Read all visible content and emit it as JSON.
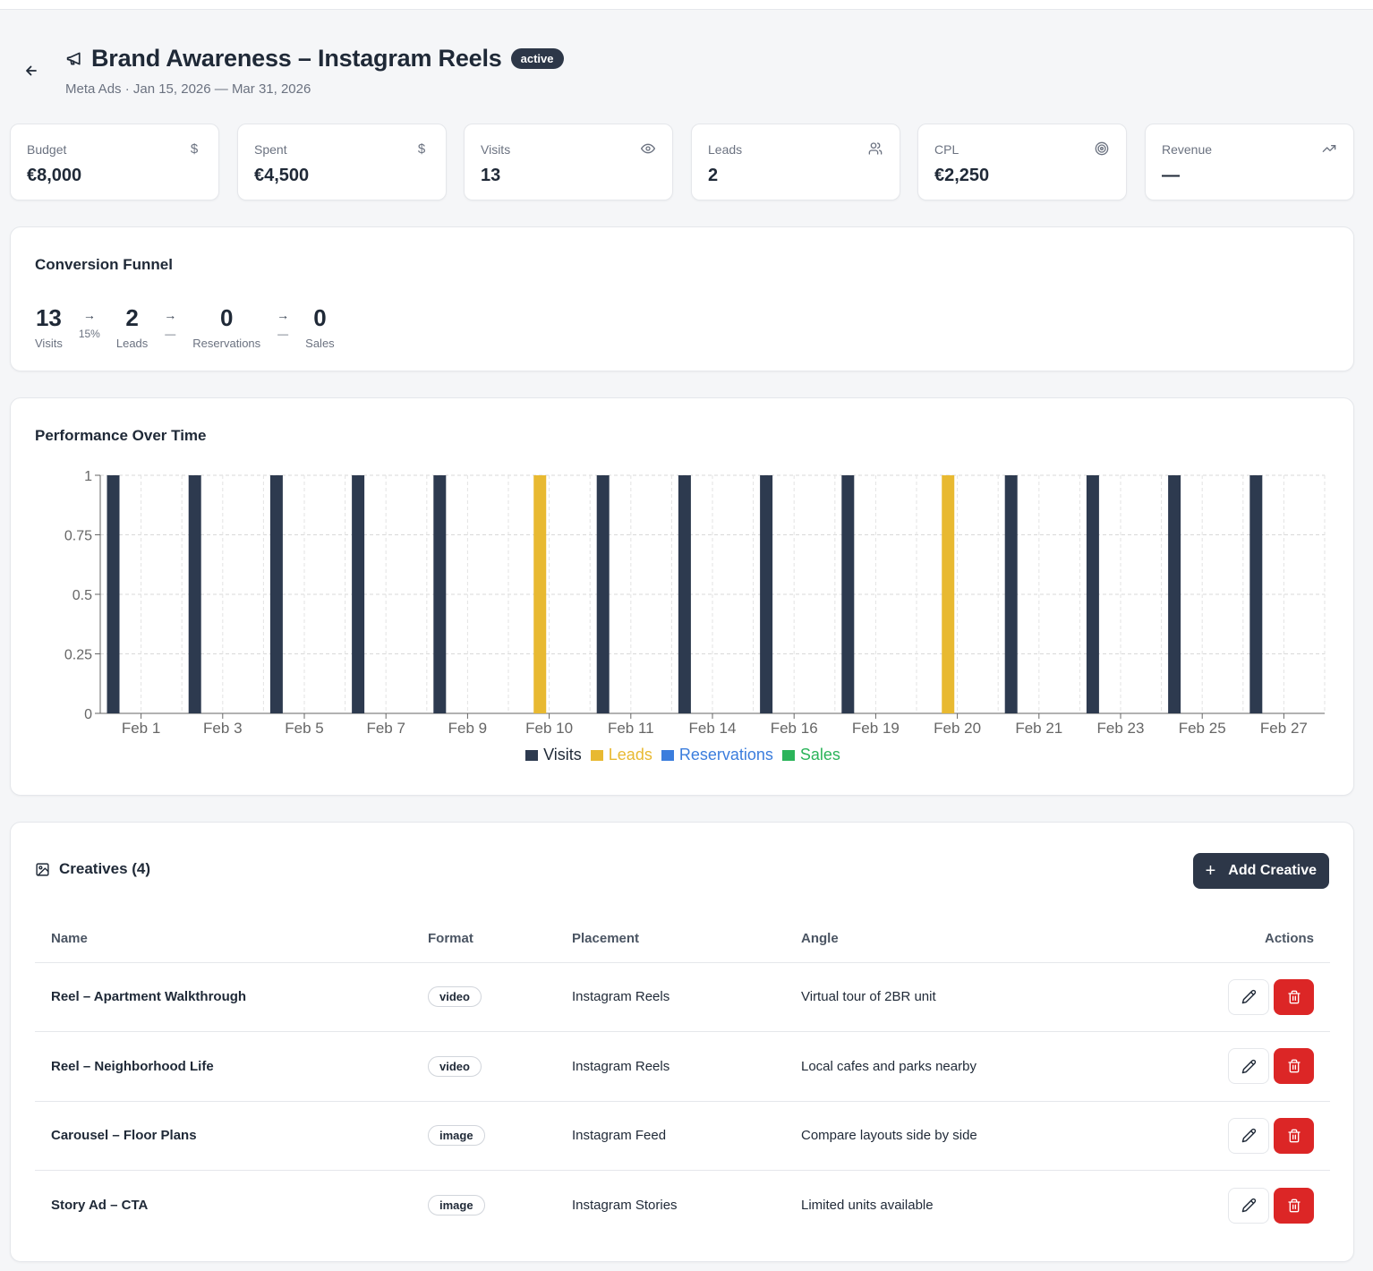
{
  "header": {
    "title": "Brand Awareness – Instagram Reels",
    "status": "active",
    "subtitle": "Meta Ads · Jan 15, 2026 — Mar 31, 2026"
  },
  "stats": [
    {
      "label": "Budget",
      "value": "€8,000",
      "icon": "dollar-icon"
    },
    {
      "label": "Spent",
      "value": "€4,500",
      "icon": "dollar-icon"
    },
    {
      "label": "Visits",
      "value": "13",
      "icon": "eye-icon"
    },
    {
      "label": "Leads",
      "value": "2",
      "icon": "users-icon"
    },
    {
      "label": "CPL",
      "value": "€2,250",
      "icon": "target-icon"
    },
    {
      "label": "Revenue",
      "value": "—",
      "icon": "trending-up-icon"
    }
  ],
  "funnel": {
    "title": "Conversion Funnel",
    "steps": [
      {
        "value": "13",
        "label": "Visits"
      },
      {
        "value": "2",
        "label": "Leads"
      },
      {
        "value": "0",
        "label": "Reservations"
      },
      {
        "value": "0",
        "label": "Sales"
      }
    ],
    "arrows": [
      "→",
      "→",
      "→"
    ],
    "rates": [
      "15%",
      "—",
      "—"
    ]
  },
  "performance": {
    "title": "Performance Over Time"
  },
  "chart_data": {
    "type": "bar",
    "title": "Performance Over Time",
    "categories": [
      "Feb 1",
      "Feb 3",
      "Feb 5",
      "Feb 7",
      "Feb 9",
      "Feb 10",
      "Feb 11",
      "Feb 14",
      "Feb 16",
      "Feb 19",
      "Feb 20",
      "Feb 21",
      "Feb 23",
      "Feb 25",
      "Feb 27"
    ],
    "series": [
      {
        "name": "Visits",
        "color": "#2d3a4f",
        "values": [
          1,
          1,
          1,
          1,
          1,
          0,
          1,
          1,
          1,
          1,
          0,
          1,
          1,
          1,
          1
        ]
      },
      {
        "name": "Leads",
        "color": "#e8b931",
        "values": [
          0,
          0,
          0,
          0,
          0,
          1,
          0,
          0,
          0,
          0,
          1,
          0,
          0,
          0,
          0
        ]
      },
      {
        "name": "Reservations",
        "color": "#3b7ddd",
        "values": [
          0,
          0,
          0,
          0,
          0,
          0,
          0,
          0,
          0,
          0,
          0,
          0,
          0,
          0,
          0
        ]
      },
      {
        "name": "Sales",
        "color": "#2bb45a",
        "values": [
          0,
          0,
          0,
          0,
          0,
          0,
          0,
          0,
          0,
          0,
          0,
          0,
          0,
          0,
          0
        ]
      }
    ],
    "yticks": [
      "0",
      "0.25",
      "0.5",
      "0.75",
      "1"
    ],
    "ylim": [
      0,
      1
    ],
    "grid": true,
    "legend_position": "bottom"
  },
  "creatives": {
    "title": "Creatives (4)",
    "add_label": "Add Creative",
    "columns": [
      "Name",
      "Format",
      "Placement",
      "Angle",
      "Actions"
    ],
    "rows": [
      {
        "name": "Reel – Apartment Walkthrough",
        "format": "video",
        "placement": "Instagram Reels",
        "angle": "Virtual tour of 2BR unit"
      },
      {
        "name": "Reel – Neighborhood Life",
        "format": "video",
        "placement": "Instagram Reels",
        "angle": "Local cafes and parks nearby"
      },
      {
        "name": "Carousel – Floor Plans",
        "format": "image",
        "placement": "Instagram Feed",
        "angle": "Compare layouts side by side"
      },
      {
        "name": "Story Ad – CTA",
        "format": "image",
        "placement": "Instagram Stories",
        "angle": "Limited units available"
      }
    ]
  }
}
